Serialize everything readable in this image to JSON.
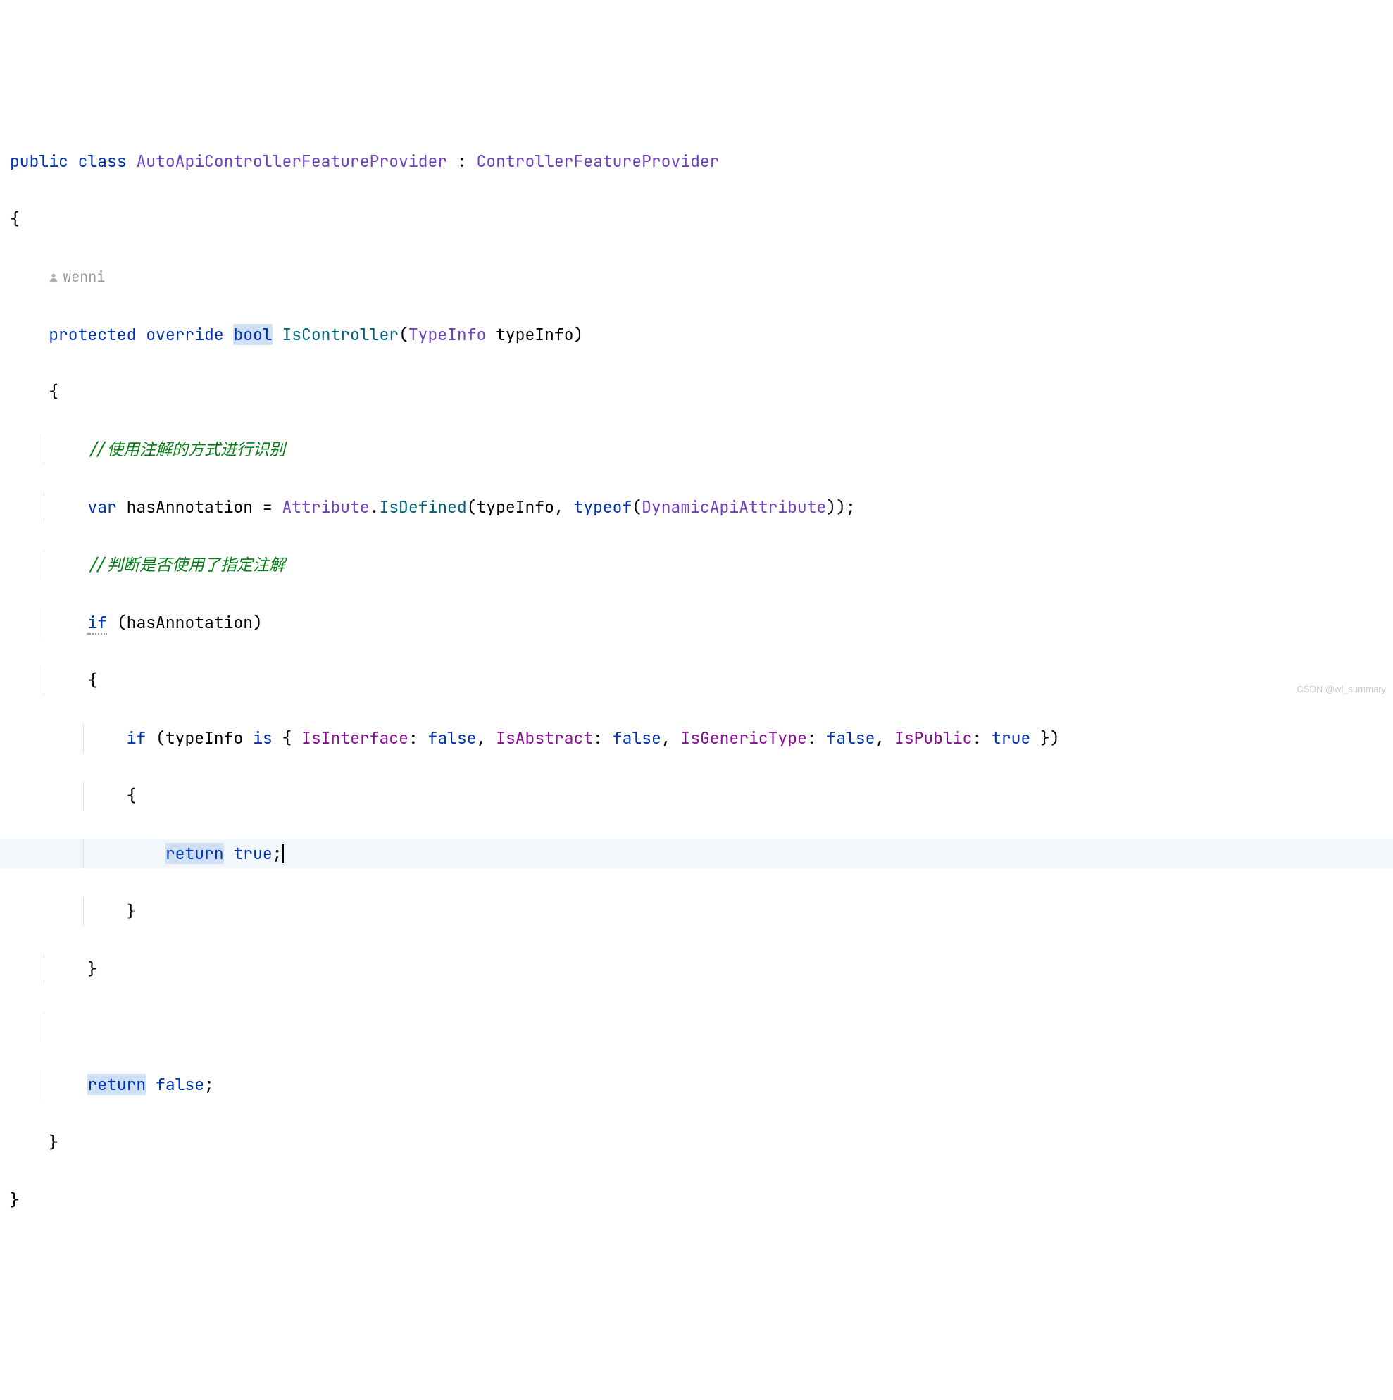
{
  "code": {
    "kw_public": "public",
    "kw_class": "class",
    "class_name": "AutoApiControllerFeatureProvider",
    "colon": " : ",
    "base_class": "ControllerFeatureProvider",
    "open_brace": "{",
    "close_brace": "}",
    "author_hint": "wenni",
    "kw_protected": "protected",
    "kw_override": "override",
    "kw_bool": "bool",
    "method_name": "IsController",
    "param_type": "TypeInfo",
    "param_name": "typeInfo",
    "comment1": "//使用注解的方式进行识别",
    "kw_var": "var",
    "local_var": "hasAnnotation",
    "equals": " = ",
    "attribute_class": "Attribute",
    "dot": ".",
    "isdefined": "IsDefined",
    "comma_sp": ", ",
    "kw_typeof": "typeof",
    "dynamic_attr": "DynamicApiAttribute",
    "comment2": "//判断是否使用了指定注解",
    "kw_if": "if",
    "kw_is": "is",
    "prop_isinterface": "IsInterface",
    "prop_isabstract": "IsAbstract",
    "prop_isgeneric": "IsGenericType",
    "prop_ispublic": "IsPublic",
    "kw_false": "false",
    "kw_true": "true",
    "kw_return": "return",
    "lparen": "(",
    "rparen": ")",
    "lbrace_pat": "{ ",
    "rbrace_pat": " }",
    "semi": ";",
    "colon_sp": ": "
  },
  "watermark": "CSDN @wl_summary"
}
